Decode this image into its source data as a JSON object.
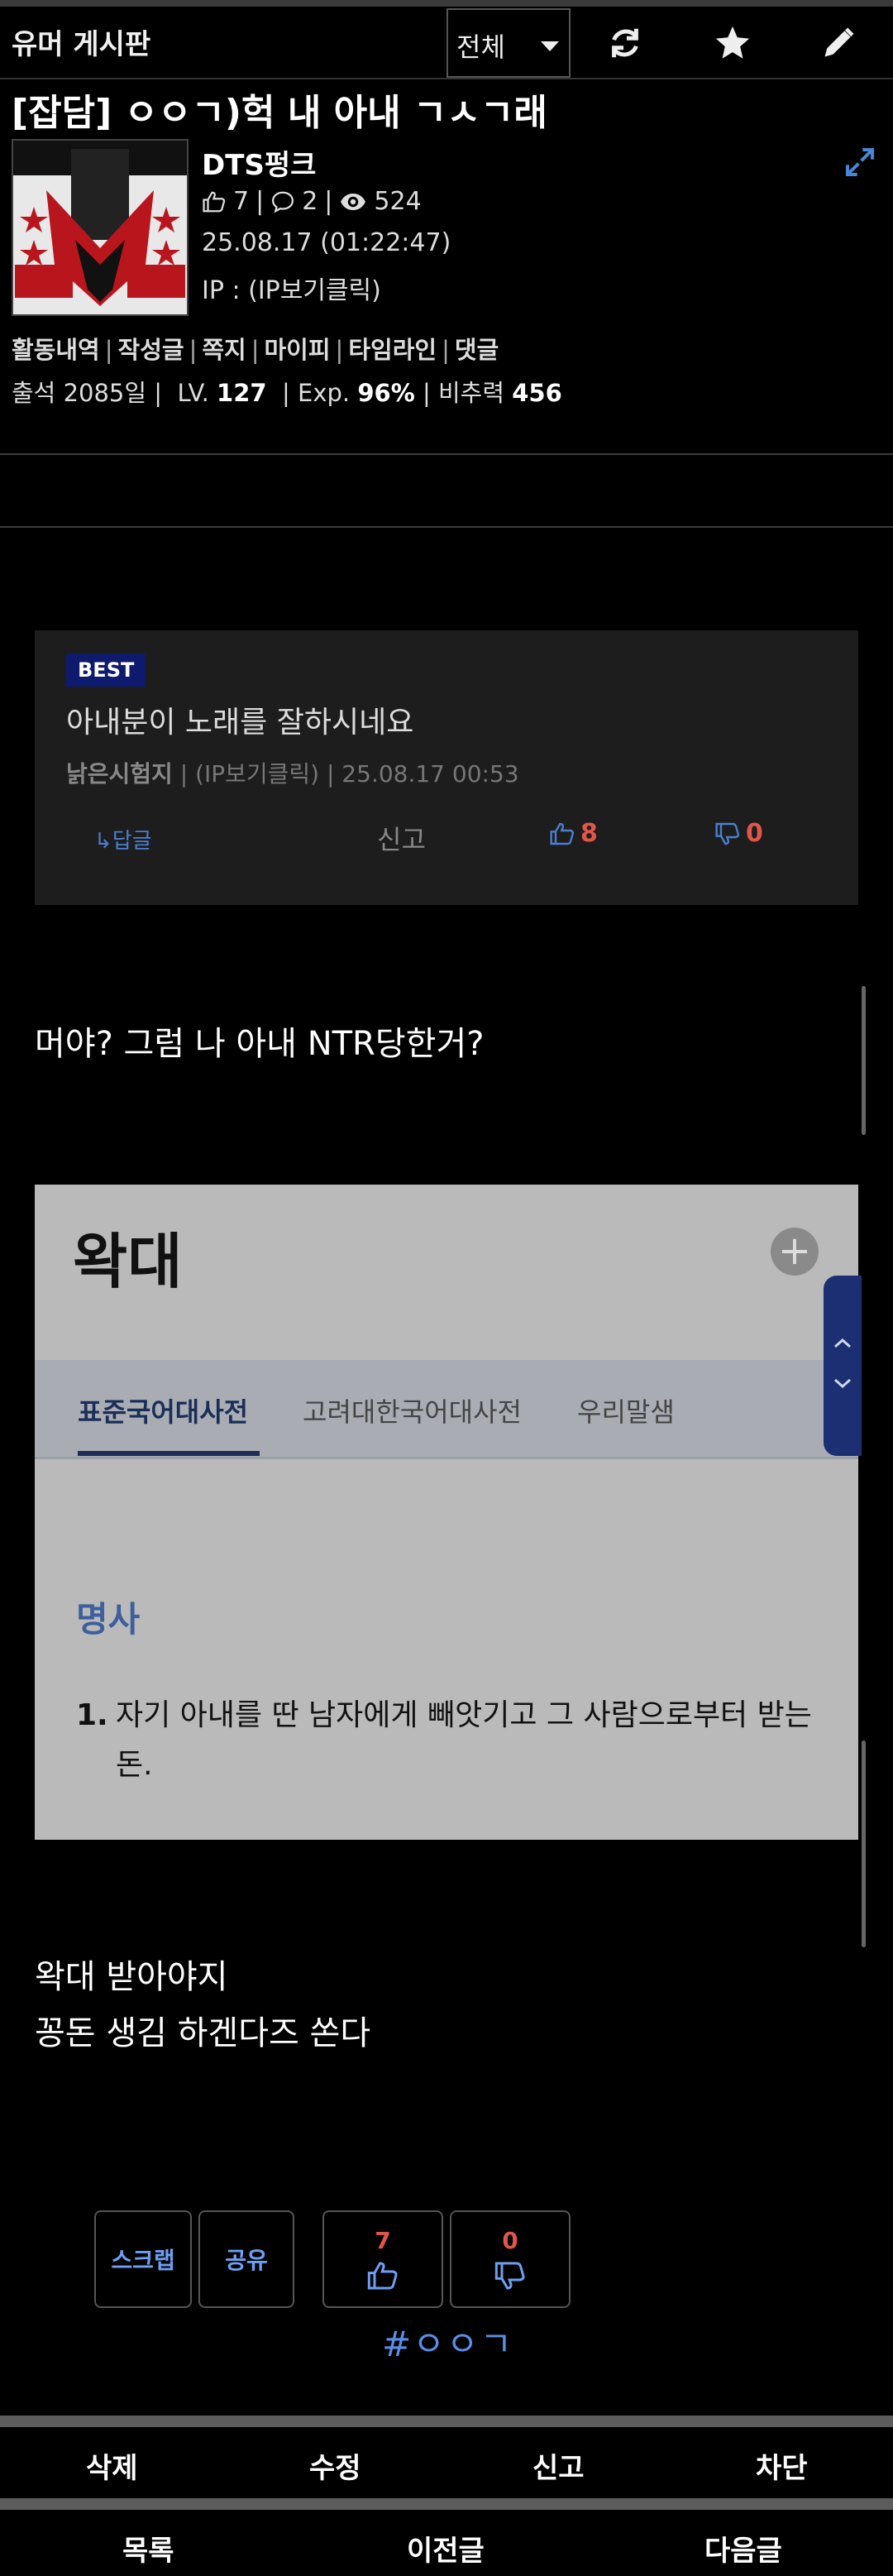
{
  "header": {
    "board_name": "유머 게시판",
    "filter_value": "전체",
    "refresh_icon": "refresh-icon",
    "favorite_icon": "star-icon",
    "write_icon": "pencil-icon"
  },
  "post": {
    "title": "[잡담] ㅇㅇㄱ)헉 내 아내 ㄱㅅㄱ래",
    "author": "DTS펑크",
    "likes": "7",
    "comments": "2",
    "views": "524",
    "date": "25.08.17 (01:22:47)",
    "ip": "IP : (IP보기클릭)",
    "links": [
      "활동내역",
      "작성글",
      "쪽지",
      "마이피",
      "타임라인",
      "댓글"
    ],
    "attendance": "출석 2085일",
    "level_label": "LV.",
    "level": "127",
    "exp_label": "Exp.",
    "exp": "96%",
    "power_label": "비추력",
    "power": "456"
  },
  "best_comment": {
    "badge": "BEST",
    "text": "아내분이 노래를 잘하시네요",
    "author": "낡은시험지",
    "meta": " | (IP보기클릭) | 25.08.17 00:53",
    "reply": "↳답글",
    "report": "신고",
    "up": "8",
    "down": "0"
  },
  "content": {
    "line1": "머야? 그럼 나 아내 NTR당한거?",
    "line2": "왁대 받아야지",
    "line3": "꽁돈 생김 하겐다즈 쏜다"
  },
  "dictionary": {
    "word": "왁대",
    "tabs": [
      "표준국어대사전",
      "고려대한국어대사전",
      "우리말샘"
    ],
    "pos": "명사",
    "def_num": "1.",
    "def_line1": "자기 아내를 딴 남자에게 빼앗기고 그 사람으로부터 받는",
    "def_line2": "돈."
  },
  "actions": {
    "scrap": "스크랩",
    "share": "공유",
    "up": "7",
    "down": "0",
    "tag": "#ㅇㅇㄱ"
  },
  "bottom": {
    "delete": "삭제",
    "edit": "수정",
    "report": "신고",
    "block": "차단",
    "list": "목록",
    "prev": "이전글",
    "next": "다음글"
  },
  "colors": {
    "accent_blue": "#6e9ff2",
    "vote_red": "#e0574a",
    "best_badge": "#0d1a6e"
  }
}
